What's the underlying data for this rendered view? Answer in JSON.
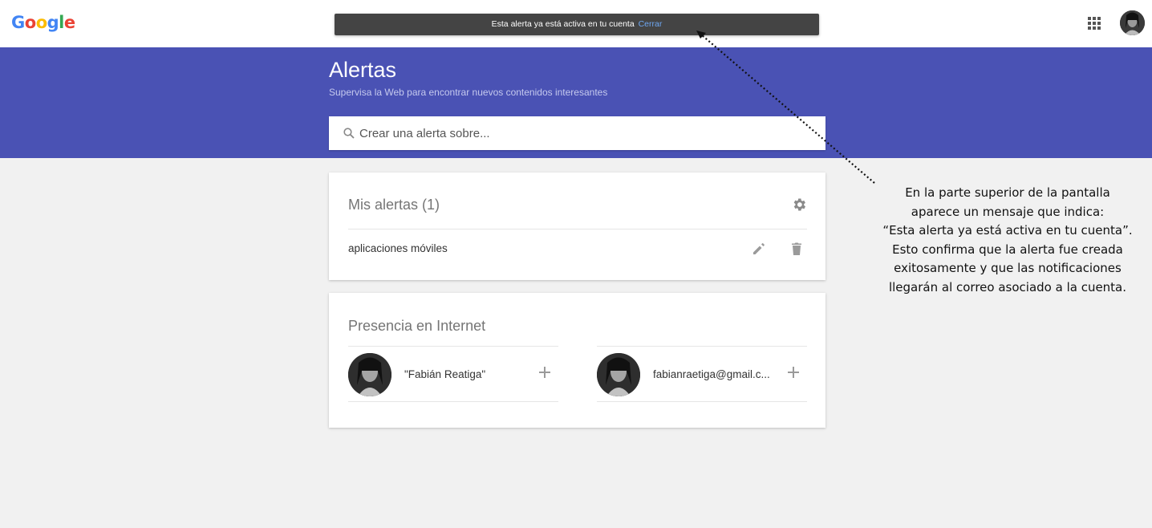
{
  "header": {
    "logo": "Google",
    "toast": {
      "message": "Esta alerta ya está activa en tu cuenta",
      "close_label": "Cerrar"
    },
    "apps_icon": "apps-grid-icon",
    "avatar": "profile-avatar"
  },
  "hero": {
    "title": "Alertas",
    "subtitle": "Supervisa la Web para encontrar nuevos contenidos interesantes",
    "search": {
      "placeholder": "Crear una alerta sobre...",
      "icon": "search-icon"
    }
  },
  "my_alerts": {
    "title": "Mis alertas",
    "count": "(1)",
    "settings_icon": "gear-icon",
    "items": [
      {
        "label": "aplicaciones móviles",
        "edit_icon": "pencil-icon",
        "delete_icon": "trash-icon"
      }
    ]
  },
  "presence": {
    "title": "Presencia en Internet",
    "items": [
      {
        "label": "\"Fabián Reatiga\"",
        "add_icon": "plus-icon"
      },
      {
        "label": "fabianraetiga@gmail.c...",
        "add_icon": "plus-icon"
      }
    ]
  },
  "annotation": {
    "lines": [
      "En la parte superior de la pantalla",
      "aparece un mensaje que indica:",
      "“Esta alerta ya está activa en tu cuenta”.",
      "Esto confirma que la alerta fue creada",
      "exitosamente y que las notificaciones",
      "llegarán al correo asociado a la cuenta."
    ]
  },
  "colors": {
    "hero_bg": "#4a52b4",
    "toast_bg": "#444444",
    "toast_link": "#6ea7f2",
    "page_bg": "#f1f1f1",
    "google_blue": "#4285f4",
    "google_red": "#ea4335",
    "google_yellow": "#fbbc05",
    "google_green": "#34a853"
  }
}
